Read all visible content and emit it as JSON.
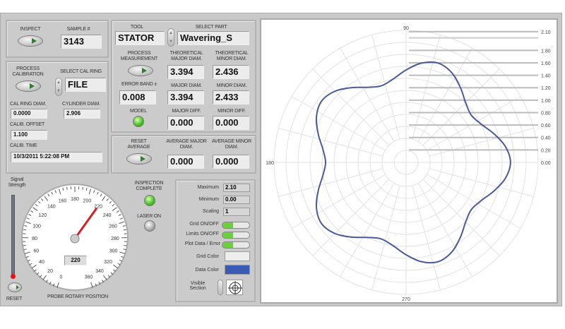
{
  "inspect": {
    "label": "INSPECT",
    "sample_label": "SAMPLE #",
    "sample": "3143"
  },
  "calibration": {
    "process_label": "PROCESS CALIBRATION",
    "select_label": "SELECT CAL RING",
    "select_value": "FILE",
    "ring_diam_label": "CAL RING DIAM.",
    "ring_diam": "0.0000",
    "cyl_diam_label": "CYLINDER DIAM.",
    "cyl_diam": "2.906",
    "offset_label": "CALIB. OFFSET",
    "offset": "1.100",
    "time_label": "CALIB. TIME",
    "time": "10/3/2011 5:22:08 PM"
  },
  "tool": {
    "tool_label": "TOOL",
    "tool": "STATOR",
    "part_label": "SELECT PART",
    "part": "Wavering_S",
    "process_label": "PROCESS MEASUREMENT",
    "th_major_label": "THEORETICAL MAJOR DIAM.",
    "th_major": "3.394",
    "th_minor_label": "THEORETICAL MINOR DIAM.",
    "th_minor": "2.436",
    "error_label": "ERROR BAND ±",
    "error": "0.008",
    "major_label": "MAJOR DIAM.",
    "major": "3.394",
    "minor_label": "MINOR DIAM.",
    "minor": "2.433",
    "model_label": "MODEL",
    "major_diff_label": "MAJOR DIFF.",
    "major_diff": "0.000",
    "minor_diff_label": "MINOR DIFF.",
    "minor_diff": "0.000"
  },
  "average": {
    "reset_label": "RESET AVERAGE",
    "major_label": "AVERAGE MAJOR DIAM.",
    "major": "0.000",
    "minor_label": "AVERAGE MINOR DIAM.",
    "minor": "0.000"
  },
  "signal": {
    "label": "Signal Strength",
    "level": 0.0,
    "reset_label": "RESET"
  },
  "gauge": {
    "label": "PROBE ROTARY POSITION",
    "value": 220,
    "readout": "220",
    "ticks": [
      "0",
      "20",
      "40",
      "60",
      "80",
      "100",
      "120",
      "140",
      "160",
      "180",
      "200",
      "220",
      "240",
      "260",
      "280",
      "300",
      "320",
      "340",
      "360"
    ],
    "min": 0,
    "max": 360
  },
  "status": {
    "complete_label": "INSPECTION COMPLETE",
    "complete_on": true,
    "laser_label": "LASER ON",
    "laser_on": false
  },
  "settings": {
    "max_label": "Maximum",
    "max": "2.10",
    "min_label": "Minimum",
    "min": "0.00",
    "scaling_label": "Scaling",
    "scaling": "1",
    "grid_label": "Grid ON/OFF",
    "limits_label": "Limits ON/OFF",
    "plot_label": "Plot Data / Error",
    "grid_color_label": "Grid Color",
    "data_color_label": "Data Color",
    "visible_label": "Visible Section",
    "grid_color": "#eeeeee",
    "data_color": "#3a5bb5"
  },
  "chart_data": {
    "type": "polar-line",
    "angle_labels": [
      "90",
      "180",
      "270"
    ],
    "radial_ticks": [
      "0.00",
      "0.20",
      "0.40",
      "0.60",
      "0.80",
      "1.00",
      "1.20",
      "1.40",
      "1.60",
      "1.80",
      "2.10"
    ],
    "radial_range": [
      0,
      2.1
    ],
    "grid": true,
    "line_color": "#4a5a9a",
    "angles_deg": [
      0,
      9,
      18,
      27,
      36,
      45,
      54,
      63,
      72,
      81,
      90,
      99,
      108,
      117,
      126,
      135,
      144,
      153,
      162,
      171,
      180,
      189,
      198,
      207,
      216,
      225,
      234,
      243,
      252,
      261,
      270,
      279,
      288,
      297,
      306,
      315,
      324,
      333,
      342,
      351
    ],
    "radius": [
      1.66,
      1.6,
      1.47,
      1.34,
      1.28,
      1.34,
      1.47,
      1.6,
      1.66,
      1.6,
      1.47,
      1.34,
      1.28,
      1.34,
      1.47,
      1.6,
      1.66,
      1.6,
      1.47,
      1.34,
      1.28,
      1.34,
      1.47,
      1.6,
      1.66,
      1.6,
      1.47,
      1.34,
      1.28,
      1.34,
      1.47,
      1.6,
      1.66,
      1.6,
      1.47,
      1.34,
      1.28,
      1.34,
      1.47,
      1.6
    ]
  }
}
